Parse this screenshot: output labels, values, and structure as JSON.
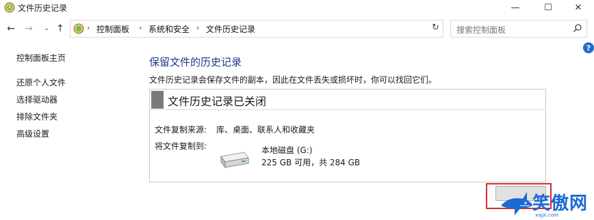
{
  "window": {
    "title": "文件历史记录",
    "minimize": "—",
    "maximize": "☐",
    "close": "✕"
  },
  "nav": {
    "back": "←",
    "forward": "→",
    "recent": "⌄",
    "up": "↑"
  },
  "address": {
    "breadcrumbs": [
      "控制面板",
      "系统和安全",
      "文件历史记录"
    ],
    "separator": "›",
    "dropdown": "⌄",
    "refresh": "↻"
  },
  "search": {
    "placeholder": "搜索控制面板"
  },
  "help": "?",
  "sidebar": {
    "home": "控制面板主页",
    "items": [
      {
        "label": "还原个人文件"
      },
      {
        "label": "选择驱动器"
      },
      {
        "label": "排除文件夹"
      },
      {
        "label": "高级设置"
      }
    ]
  },
  "main": {
    "title": "保留文件的历史记录",
    "description": "文件历史记录会保存文件的副本，因此在文件丢失或损坏时，你可以找回它们。",
    "status_title": "文件历史记录已关闭",
    "source_label": "文件复制来源:",
    "source_value": "库、桌面、联系人和收藏夹",
    "dest_label": "将文件复制到:",
    "drive_name": "本地磁盘 (G:)",
    "drive_size": "225 GB 可用，共 284 GB"
  },
  "watermark": {
    "text": "笑傲网",
    "url": "xajjn.com"
  },
  "colors": {
    "title_blue": "#1a3a8a",
    "highlight_red": "#d42a2a",
    "help_blue": "#1e6fc8"
  }
}
